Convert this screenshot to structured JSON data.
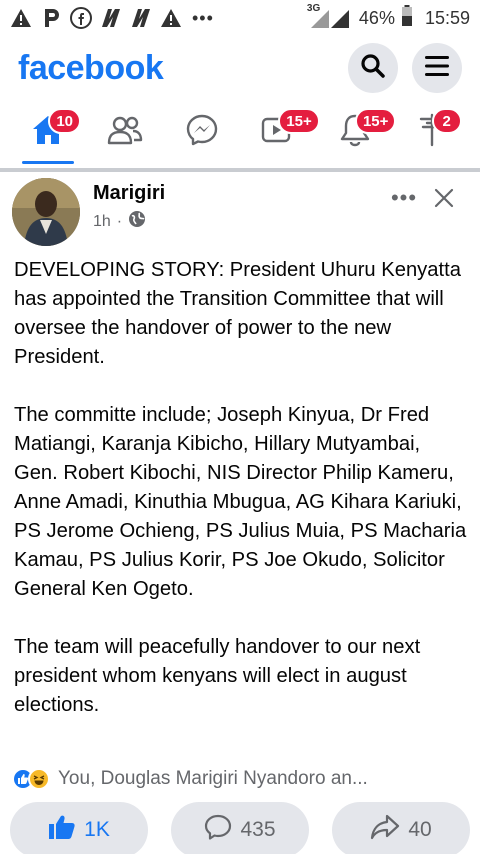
{
  "status_bar": {
    "battery": "46%",
    "time": "15:59",
    "network": "3G",
    "icons": [
      "alert-icon",
      "p-icon",
      "facebook-icon",
      "news-icon",
      "news-icon",
      "alert-icon",
      "more-icon",
      "signal-icon",
      "battery-icon"
    ]
  },
  "header": {
    "logo": "facebook",
    "search_icon": "search-icon",
    "menu_icon": "menu-icon"
  },
  "nav": {
    "tabs": [
      {
        "name": "home",
        "icon": "home-icon",
        "badge": "10",
        "active": true
      },
      {
        "name": "friends",
        "icon": "friends-icon",
        "badge": ""
      },
      {
        "name": "messenger",
        "icon": "messenger-icon",
        "badge": ""
      },
      {
        "name": "watch",
        "icon": "video-icon",
        "badge": "15+"
      },
      {
        "name": "notifications",
        "icon": "bell-icon",
        "badge": "15+"
      },
      {
        "name": "marketplace",
        "icon": "flag-icon",
        "badge": "2"
      }
    ]
  },
  "post": {
    "author": "Marigiri",
    "time": "1h",
    "separator": "·",
    "privacy_icon": "globe-icon",
    "paragraphs": [
      "DEVELOPING STORY: President Uhuru Kenyatta has appointed the Transition Committee that will oversee the handover of power to the new President.",
      "The committe include; Joseph Kinyua, Dr Fred Matiangi, Karanja Kibicho, Hillary Mutyambai, Gen. Robert Kibochi, NIS Director Philip Kameru, Anne Amadi, Kinuthia Mbugua, AG Kihara Kariuki, PS Jerome Ochieng, PS Julius Muia, PS Macharia Kamau, PS Julius Korir, PS Joe Okudo, Solicitor General Ken Ogeto.",
      "The team will peacefully handover to our next president whom kenyans will elect in august elections."
    ],
    "reactors": "You, Douglas Marigiri Nyandoro an...",
    "like_count": "1K",
    "comment_count": "435",
    "share_count": "40"
  },
  "colors": {
    "brand": "#1877f2",
    "badge": "#e41e3f",
    "button_bg": "#e4e6eb",
    "secondary_text": "#65676b"
  }
}
